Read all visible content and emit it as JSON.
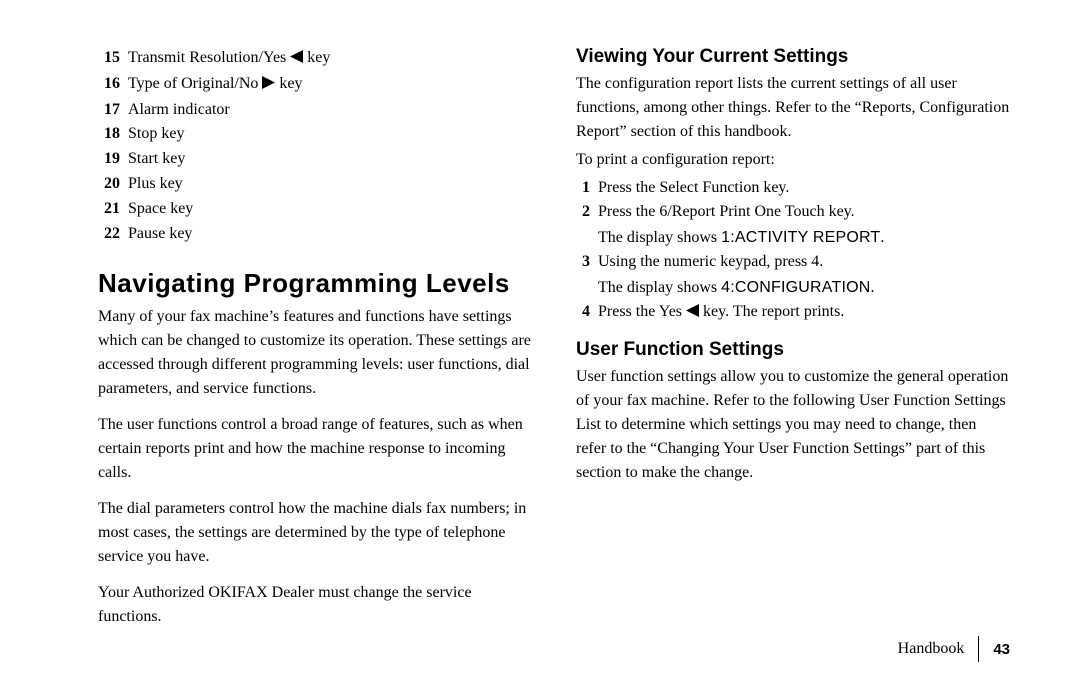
{
  "keys_list": [
    {
      "num": "15",
      "label_pre": "Transmit Resolution/Yes ",
      "icon": "left",
      "label_post": " key"
    },
    {
      "num": "16",
      "label_pre": "Type of Original/No ",
      "icon": "right",
      "label_post": " key"
    },
    {
      "num": "17",
      "label_pre": "Alarm indicator",
      "icon": null,
      "label_post": ""
    },
    {
      "num": "18",
      "label_pre": "Stop key",
      "icon": null,
      "label_post": ""
    },
    {
      "num": "19",
      "label_pre": "Start key",
      "icon": null,
      "label_post": ""
    },
    {
      "num": "20",
      "label_pre": "Plus key",
      "icon": null,
      "label_post": ""
    },
    {
      "num": "21",
      "label_pre": "Space key",
      "icon": null,
      "label_post": ""
    },
    {
      "num": "22",
      "label_pre": "Pause key",
      "icon": null,
      "label_post": ""
    }
  ],
  "left": {
    "heading": "Navigating Programming Levels",
    "p1": "Many of your fax machine’s features and functions have settings which can be changed to customize its operation. These settings are accessed through different programming levels: user functions, dial parameters, and service functions.",
    "p2": "The user functions control a broad range of features, such as when certain reports print and how the machine response to incoming calls.",
    "p3": "The dial parameters control how the machine dials fax numbers; in most cases, the settings are determined by the type of telephone service you have.",
    "p4": "Your Authorized OKIFAX Dealer must change the service functions."
  },
  "right": {
    "h_viewing": "Viewing Your Current Settings",
    "viewing_intro": "The configuration report lists the current settings of all user functions, among other things. Refer to the “Reports, Configuration Report” section of this handbook.",
    "viewing_lead": "To print a configuration report:",
    "steps": [
      {
        "n": "1",
        "text": "Press the Select Function key."
      },
      {
        "n": "2",
        "text": "Press the 6/Report Print One Touch key.",
        "sub_pre": "The display shows ",
        "code": "1:ACTIVITY REPORT",
        "sub_post": "."
      },
      {
        "n": "3",
        "text": "Using the numeric keypad, press 4.",
        "sub_pre": "The display shows ",
        "code": "4:CONFIGURATION",
        "sub_post": "."
      },
      {
        "n": "4",
        "text_pre": "Press the Yes ",
        "icon": "left",
        "text_post": " key. The report prints."
      }
    ],
    "h_user_fn": "User Function Settings",
    "user_fn_p": "User function settings allow you to customize the general operation of your fax machine. Refer to the following User Function Settings List to determine which settings you may need to change, then refer to the “Changing Your User Function Settings” part of this section to make the change."
  },
  "footer": {
    "book": "Handbook",
    "page": "43"
  }
}
